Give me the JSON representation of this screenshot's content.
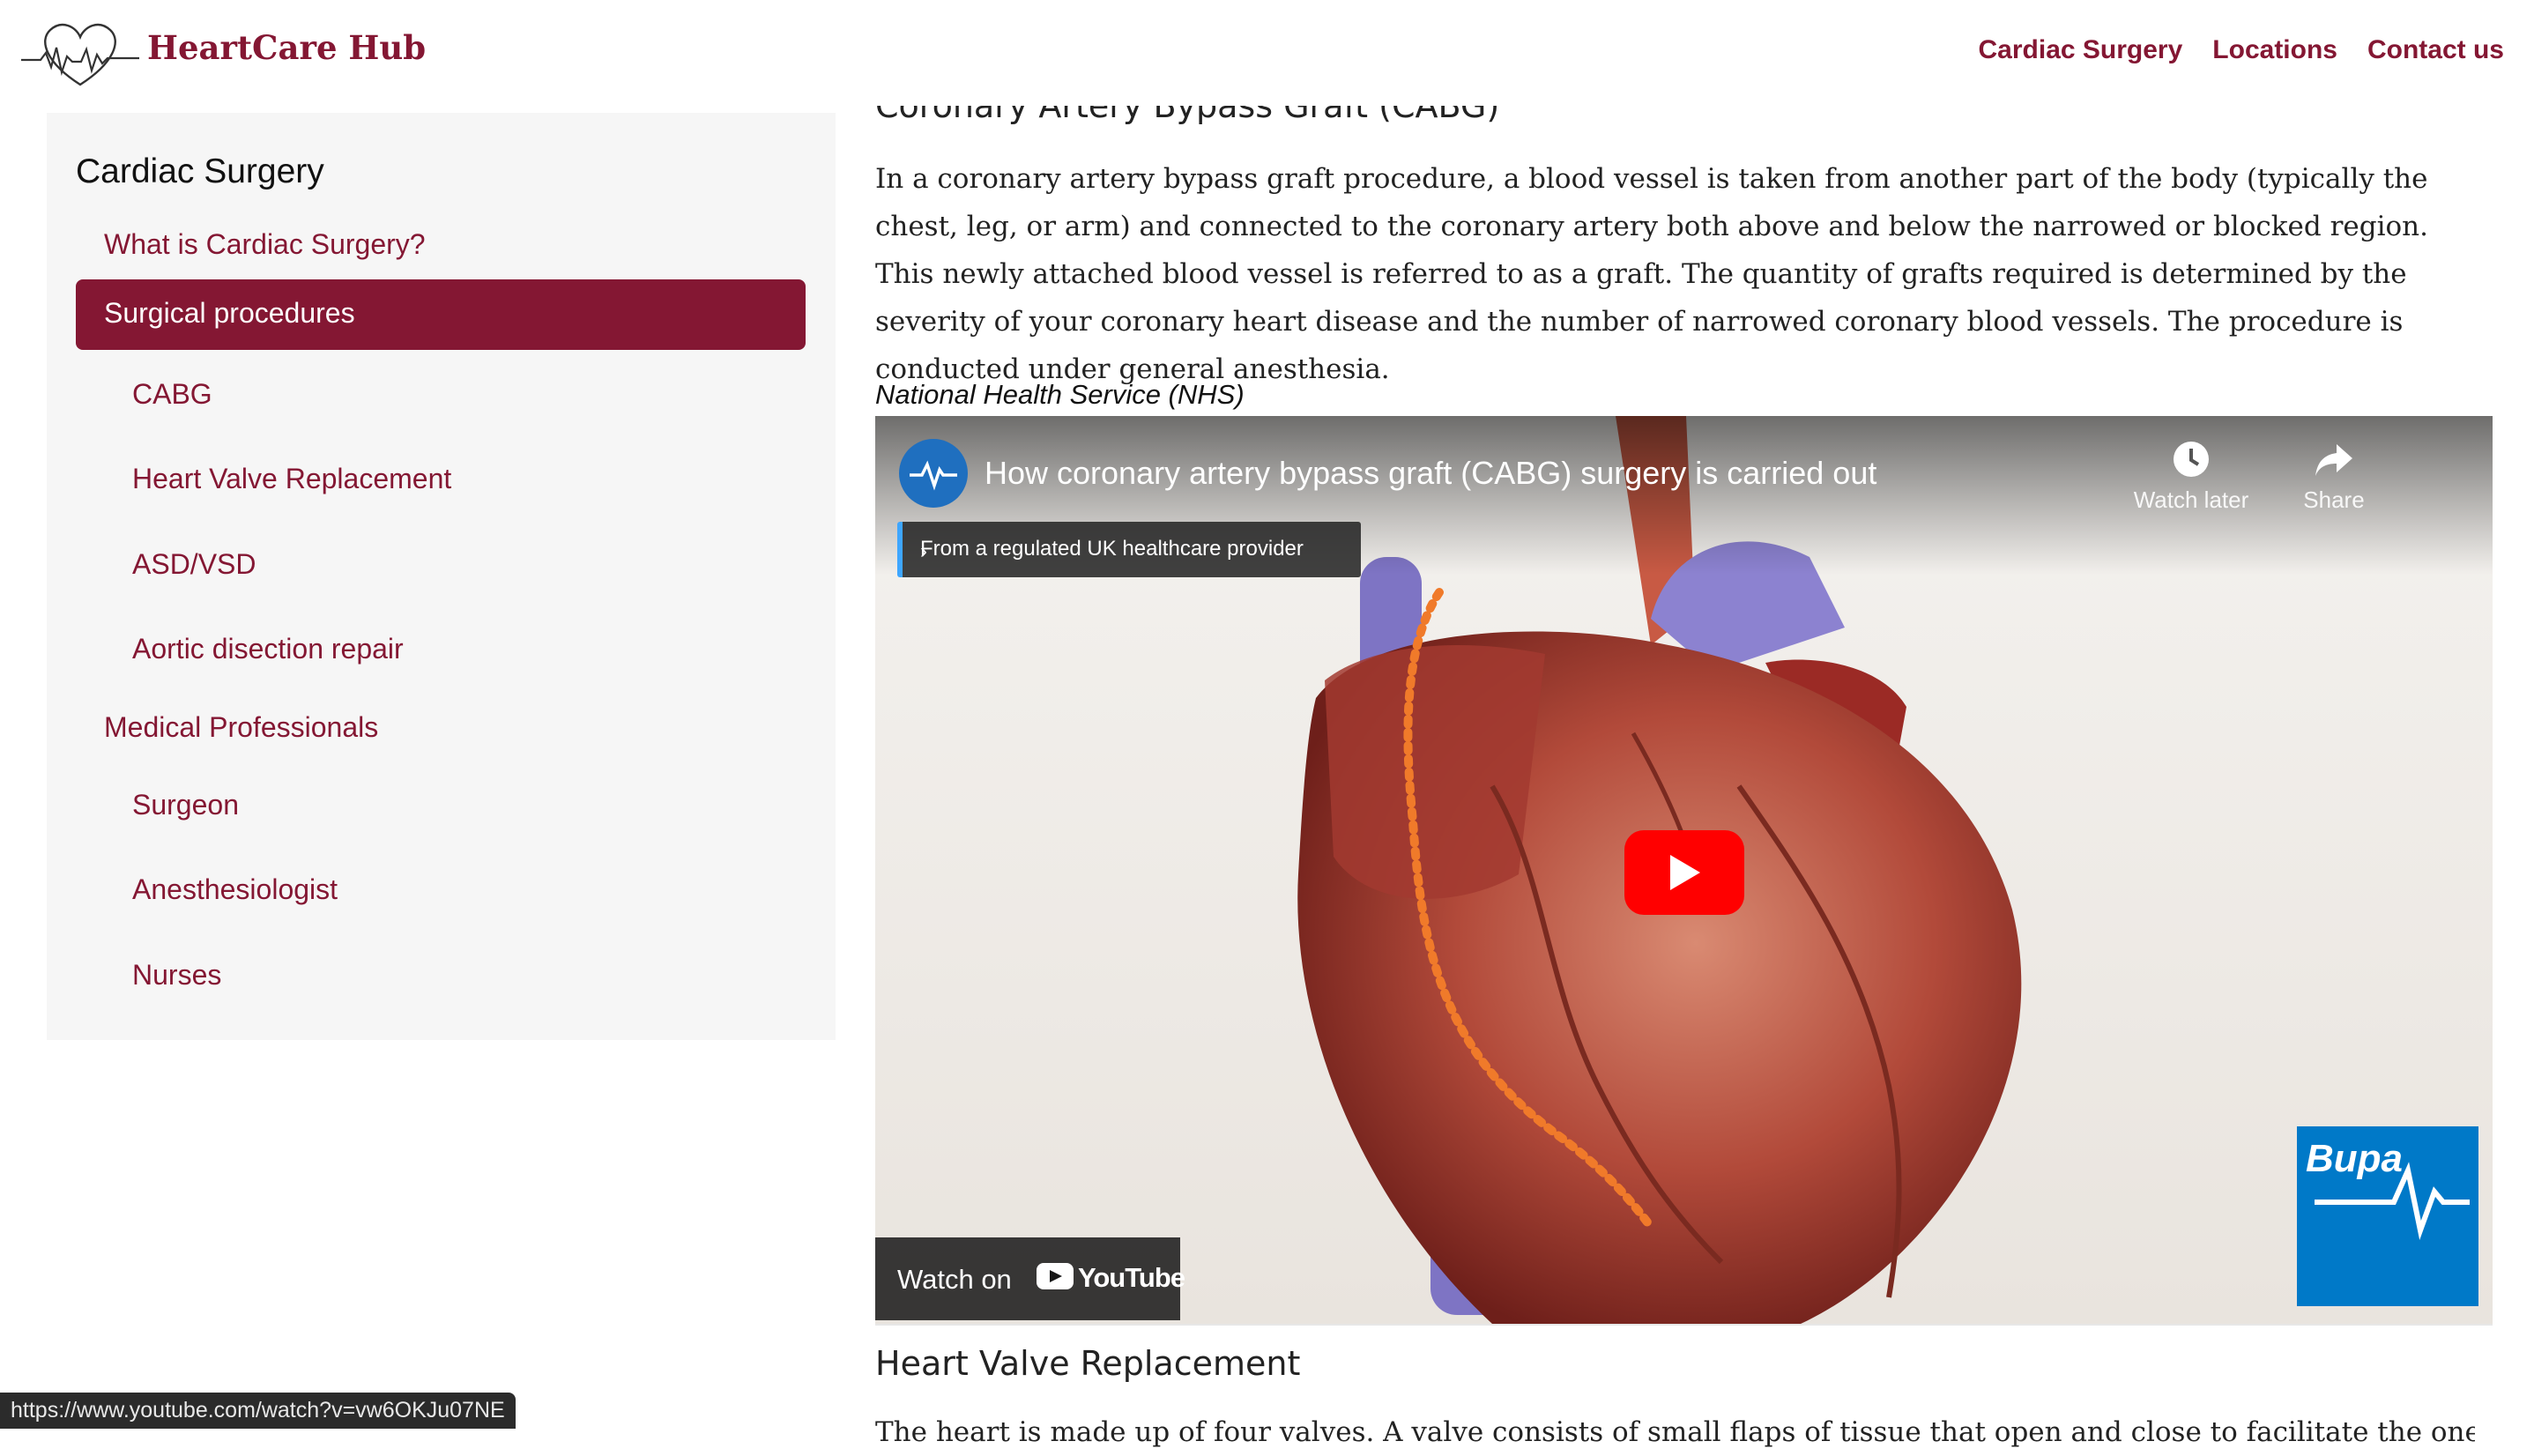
{
  "header": {
    "brand": "HeartCare Hub",
    "nav": [
      "Cardiac Surgery",
      "Locations",
      "Contact us"
    ]
  },
  "sidebar": {
    "title": "Cardiac Surgery",
    "items": [
      {
        "label": "What is Cardiac Surgery?",
        "level": 1
      },
      {
        "label": "Surgical procedures",
        "level": 1,
        "active": true
      },
      {
        "label": "CABG",
        "level": 2
      },
      {
        "label": "Heart Valve Replacement",
        "level": 2
      },
      {
        "label": "ASD/VSD",
        "level": 2
      },
      {
        "label": "Aortic disection repair",
        "level": 2
      },
      {
        "label": "Medical Professionals",
        "level": 1
      },
      {
        "label": "Surgeon",
        "level": 2
      },
      {
        "label": "Anesthesiologist",
        "level": 2
      },
      {
        "label": "Nurses",
        "level": 2
      }
    ]
  },
  "main": {
    "section_heading": "Coronary Artery Bypass Graft (CABG)",
    "paragraph": "In a coronary artery bypass graft procedure, a blood vessel is taken from another part of the body (typically the chest, leg, or arm) and connected to the coronary artery both above and below the narrowed or blocked region. This newly attached blood vessel is referred to as a graft. The quantity of grafts required is determined by the severity of your coronary heart disease and the number of narrowed coronary blood vessels. The procedure is conducted under general anesthesia.",
    "source": "National Health Service (NHS)",
    "video": {
      "title": "How coronary artery bypass graft (CABG) surgery is carried out",
      "watch_later": "Watch later",
      "share": "Share",
      "provider_notice": "From a regulated UK healthcare provider",
      "watch_on": "Watch on",
      "youtube": "YouTube",
      "watermark": "Bupa"
    },
    "next_heading": "Heart Valve Replacement",
    "next_paragraph": "The heart is made up of four valves. A valve consists of small flaps of tissue that open and close to facilitate the one-way flow of"
  },
  "statusbar": {
    "url": "https://www.youtube.com/watch?v=vw6OKJu07NE"
  },
  "colors": {
    "brand": "#841733",
    "youtube_red": "#ff0000",
    "bupa_blue": "#0079c8"
  }
}
